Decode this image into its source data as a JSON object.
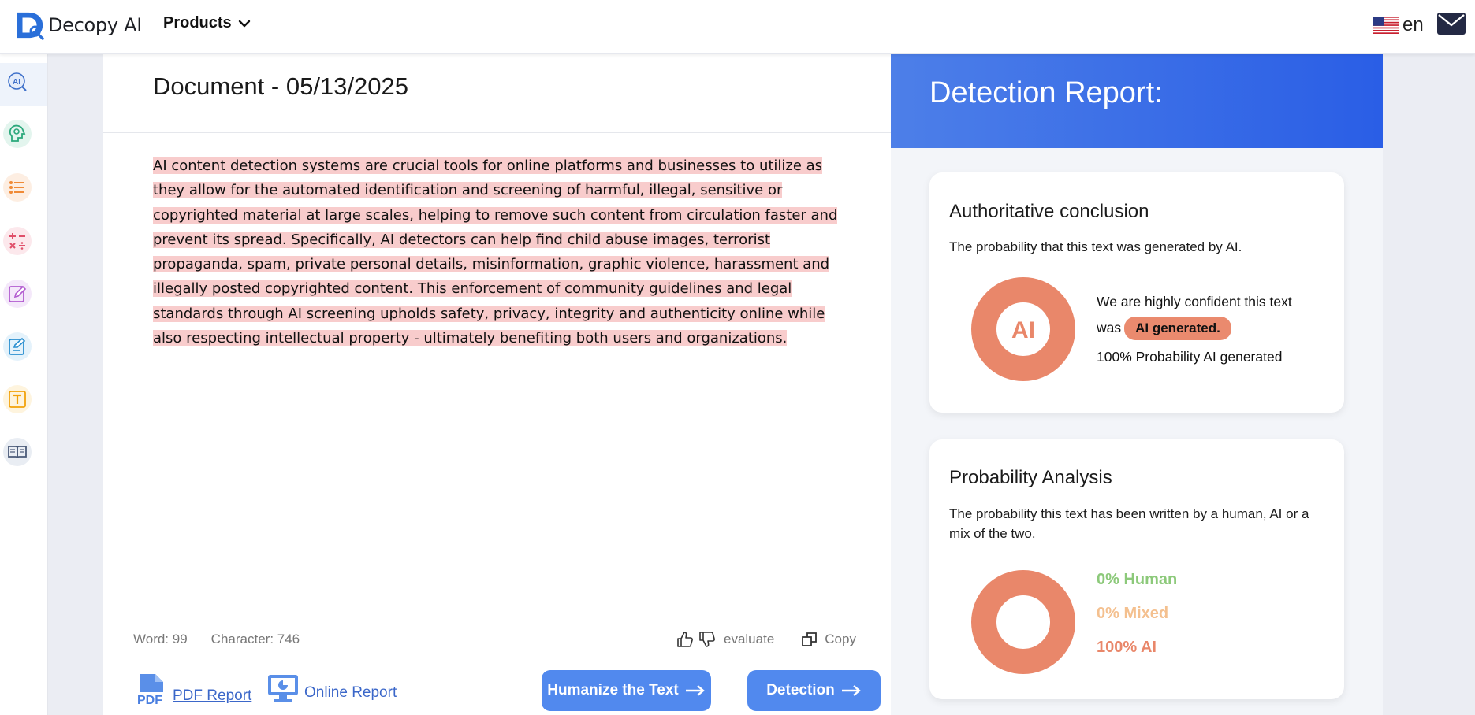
{
  "header": {
    "brand": "Decopy AI",
    "products_label": "Products",
    "language": "en"
  },
  "sidebar": {
    "items": [
      {
        "name": "ai-detector",
        "color": "#3d6fc9"
      },
      {
        "name": "humanizer",
        "color": "#2aa87b"
      },
      {
        "name": "list",
        "color": "#f08a36"
      },
      {
        "name": "calculator",
        "color": "#e0506a"
      },
      {
        "name": "editor",
        "color": "#b25bd0"
      },
      {
        "name": "writer",
        "color": "#2a8fd0"
      },
      {
        "name": "text",
        "color": "#f2a20a"
      },
      {
        "name": "reader",
        "color": "#4a5a78"
      }
    ]
  },
  "document": {
    "title": "Document - 05/13/2025",
    "lines": [
      "AI content detection systems are crucial tools for online platforms and businesses to utilize as",
      "they allow for the automated identification and screening of harmful, illegal, sensitive or",
      "copyrighted material at large scales, helping to remove such content from circulation faster and",
      "prevent its spread. Specifically, AI detectors can help find child abuse images, terrorist",
      "propaganda, spam, private personal details, misinformation, graphic violence, harassment and",
      "illegally posted copyrighted content. This enforcement of community guidelines and legal",
      "standards through AI screening upholds safety, privacy, integrity and authenticity online while",
      "also respecting intellectual property - ultimately benefiting both users and organizations."
    ],
    "word_count": "Word: 99",
    "char_count": "Character: 746",
    "evaluate_label": "evaluate",
    "copy_label": "Copy",
    "pdf_report_label": "PDF Report",
    "online_report_label": "Online Report",
    "humanize_label": "Humanize the Text",
    "detection_label": "Detection"
  },
  "report": {
    "title": "Detection Report:",
    "conclusion": {
      "title": "Authoritative conclusion",
      "subtitle": "The probability that this text was generated by AI.",
      "donut_label": "AI",
      "line1": "We are highly confident this text",
      "line2_prefix": "was",
      "badge": "AI generated.",
      "probability": "100% Probability AI generated",
      "ai_fraction": 1.0
    },
    "analysis": {
      "title": "Probability Analysis",
      "subtitle": "The probability this text has been written by a human, AI or a mix of the two.",
      "human": "0% Human",
      "mixed": "0% Mixed",
      "ai": "100% AI",
      "human_color": "#8cc97a",
      "mixed_color": "#f4c08f",
      "ai_color": "#e9876a"
    }
  }
}
